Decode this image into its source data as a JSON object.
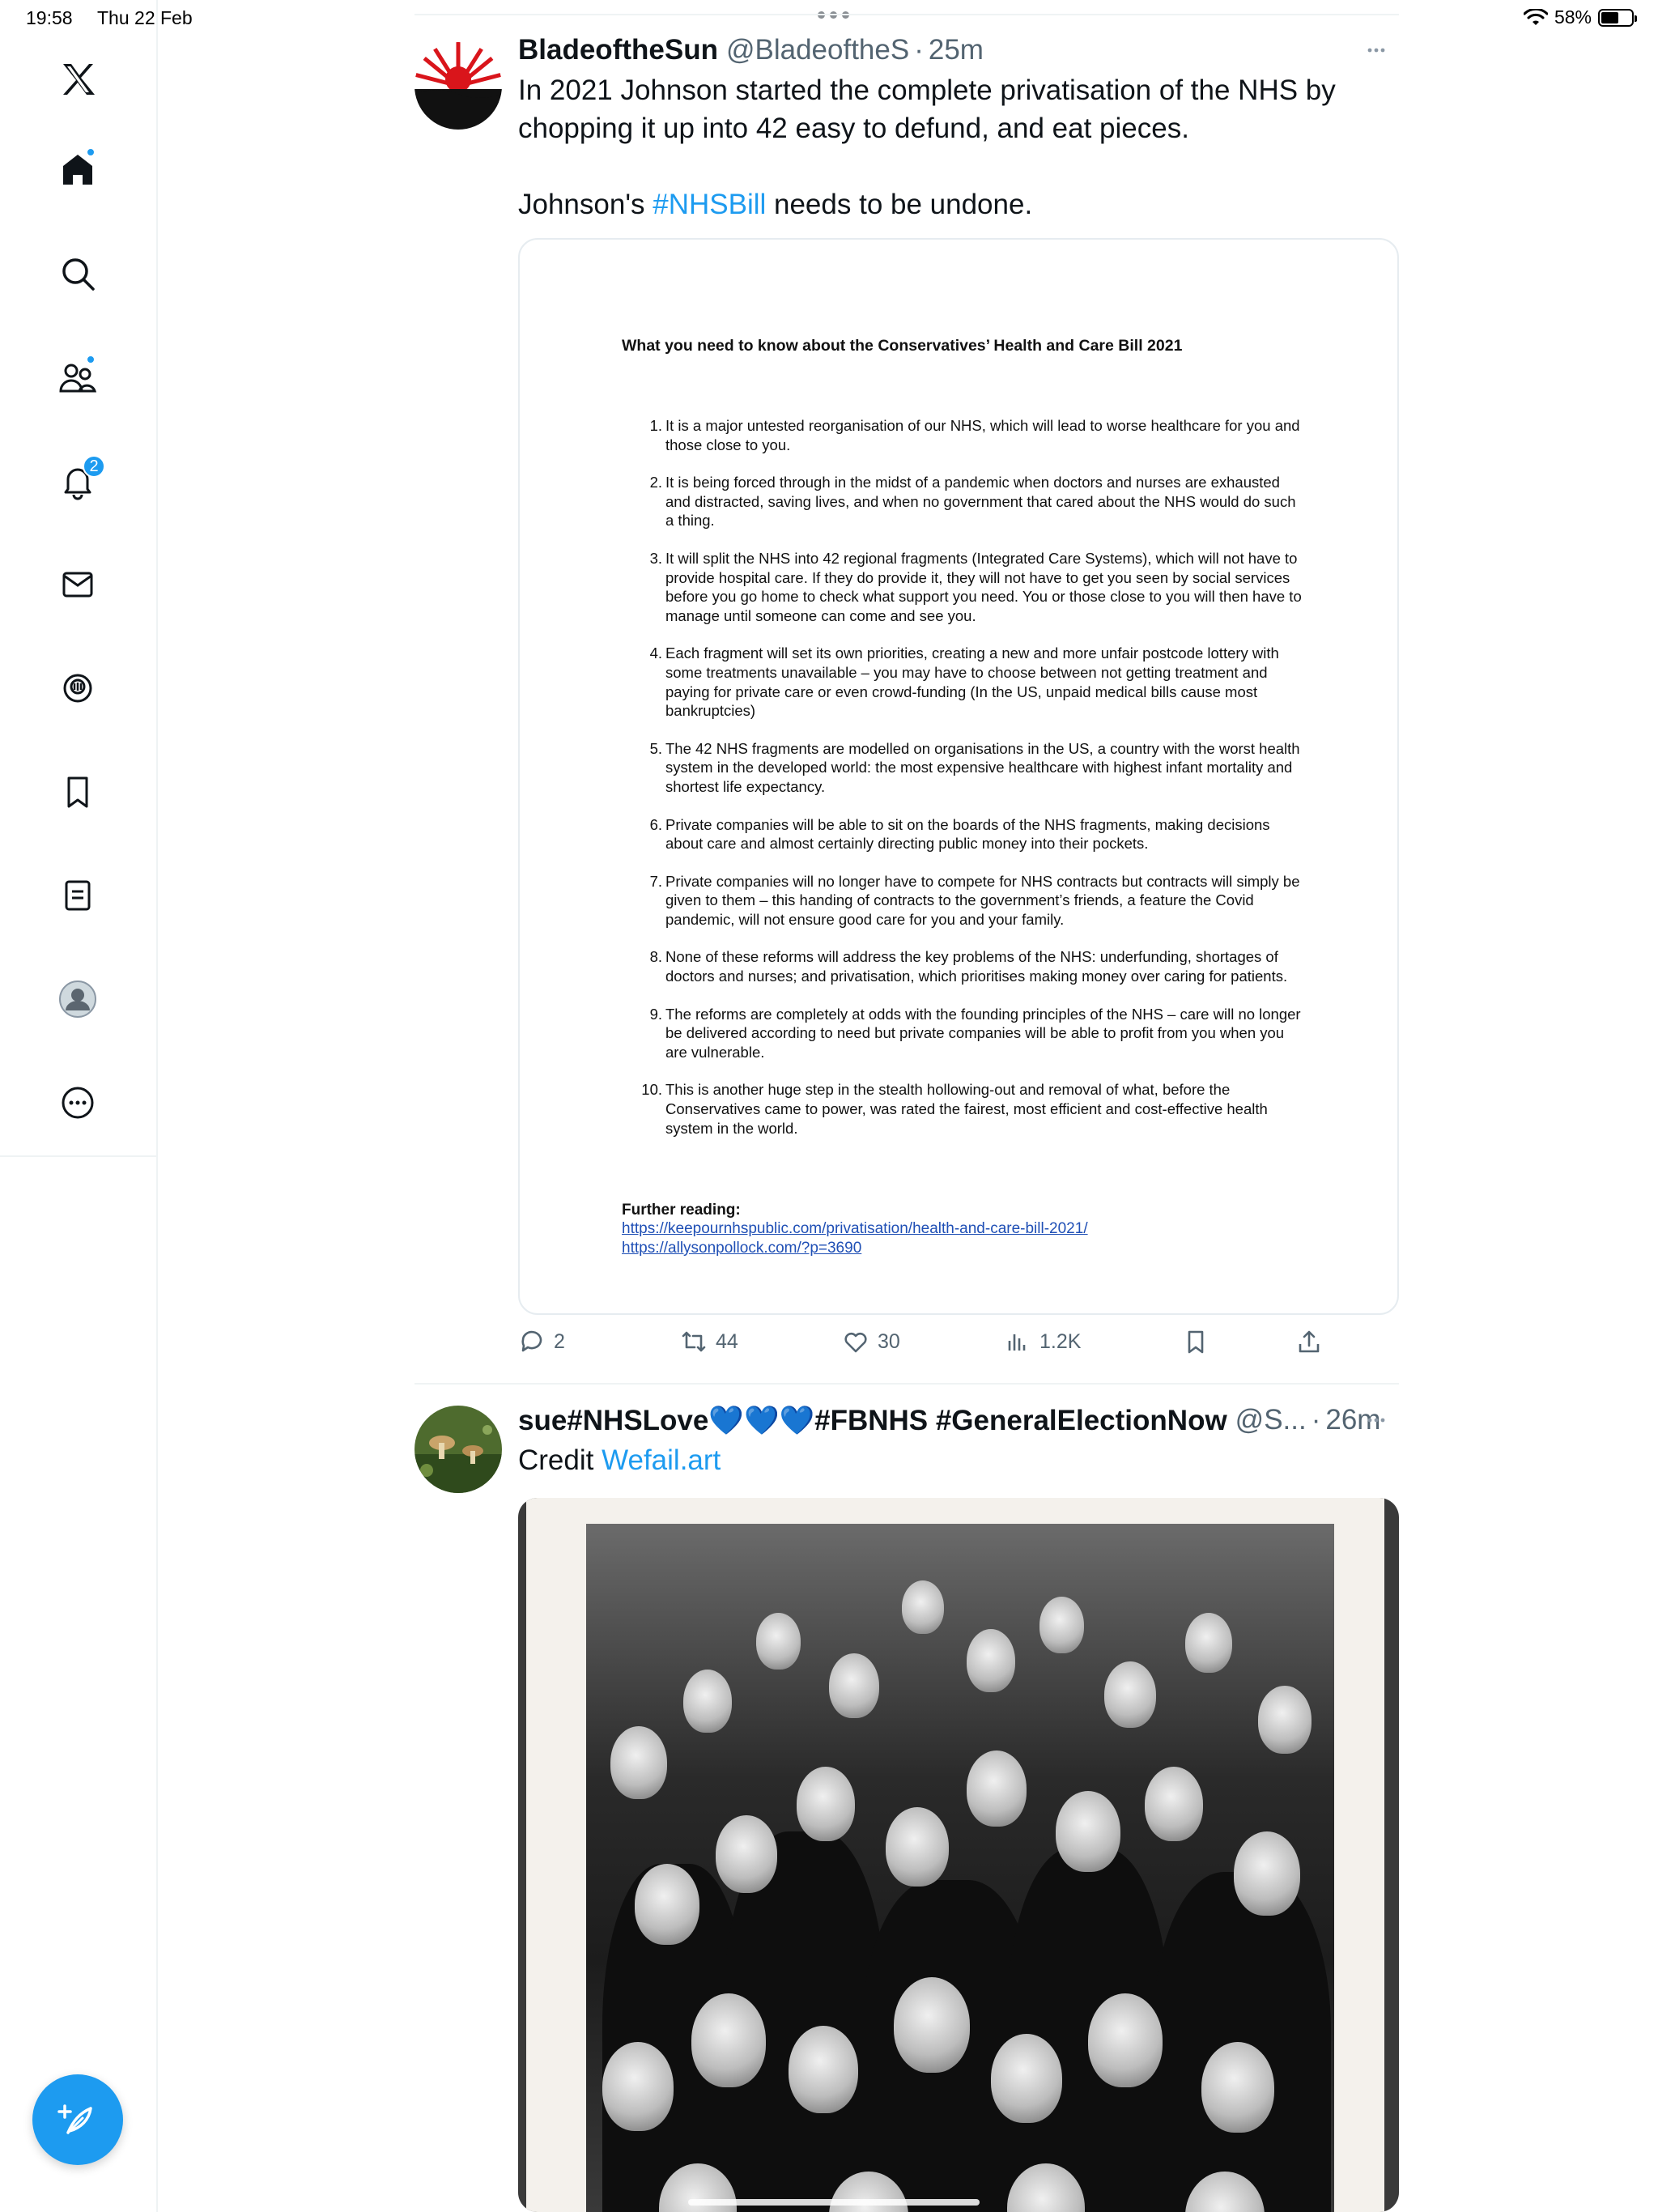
{
  "status_bar": {
    "time": "19:58",
    "date": "Thu 22 Feb",
    "battery": "58%",
    "battery_level": 0.58
  },
  "sidebar": {
    "notifications_count": "2"
  },
  "tweets": [
    {
      "display_name": "BladeoftheSun",
      "handle": "@BladeoftheS",
      "separator": "·",
      "time": "25m",
      "text_line1": "In 2021 Johnson started the complete privatisation of the NHS by chopping it up into 42 easy to defund, and eat pieces.",
      "text_line2_pre": "Johnson's ",
      "hashtag": "#NHSBill",
      "text_line2_post": " needs to be undone.",
      "document": {
        "title": "What you need to know about the Conservatives’ Health and Care Bill 2021",
        "items": [
          {
            "num": "1.",
            "text": "It is a major untested reorganisation of our NHS, which will lead to worse healthcare for you and those close to you."
          },
          {
            "num": "2.",
            "text": "It is being forced through in the midst of a pandemic when doctors and nurses are exhausted and distracted, saving lives, and when no government that cared about the NHS would do such a thing."
          },
          {
            "num": "3.",
            "text": "It will split the NHS into 42 regional fragments (Integrated Care Systems), which will not have to provide hospital care. If they do provide it, they will not have to get you seen by social services before you go home to check what support you need. You or those close to you will then have to manage until someone can come and see you."
          },
          {
            "num": "4.",
            "text": "Each fragment will set its own priorities, creating a new and more unfair postcode lottery with some treatments unavailable – you may have to choose between not getting treatment and paying for private care or even crowd-funding (In the US, unpaid medical bills cause most bankruptcies)"
          },
          {
            "num": "5.",
            "text": "The 42 NHS fragments are modelled on organisations in the US, a country with the worst health system in the developed world: the most expensive healthcare with highest infant mortality and shortest life expectancy."
          },
          {
            "num": "6.",
            "text": "Private companies will be able to sit on the boards of the NHS fragments, making decisions about care and almost certainly directing public money into their pockets."
          },
          {
            "num": "7.",
            "text": "Private companies will no longer have to compete for NHS contracts but contracts will simply be given to them – this handing of contracts to the government’s friends, a feature the Covid pandemic, will not ensure good care for you and your family."
          },
          {
            "num": "8.",
            "text": "None of these reforms will address the key problems of the NHS: underfunding, shortages of doctors and nurses; and privatisation, which prioritises making money over caring for patients."
          },
          {
            "num": "9.",
            "text": "The reforms are completely at odds with the founding principles of the NHS – care will no longer be delivered according to need but private companies will be able to profit from you when you are vulnerable."
          },
          {
            "num": "10.",
            "text": "This is another huge step in the stealth hollowing-out and removal of what, before the Conservatives came to power, was rated the fairest, most efficient and cost-effective health system in the world."
          }
        ],
        "further_label": "Further reading:",
        "link1": "https://keepournhspublic.com/privatisation/health-and-care-bill-2021/",
        "link2": "https://allysonpollock.com/?p=3690"
      },
      "stats": {
        "replies": "2",
        "retweets": "44",
        "likes": "30",
        "views": "1.2K"
      }
    },
    {
      "display_name": "sue#NHSLove💙💙💙#FBNHS #GeneralElectionNow",
      "handle": "@S...",
      "separator": "·",
      "time": "26m",
      "text_pre": "Credit ",
      "link": "Wefail.art"
    }
  ],
  "colors": {
    "accent": "#1d9bf0",
    "text": "#0f1419",
    "secondary": "#536471"
  }
}
